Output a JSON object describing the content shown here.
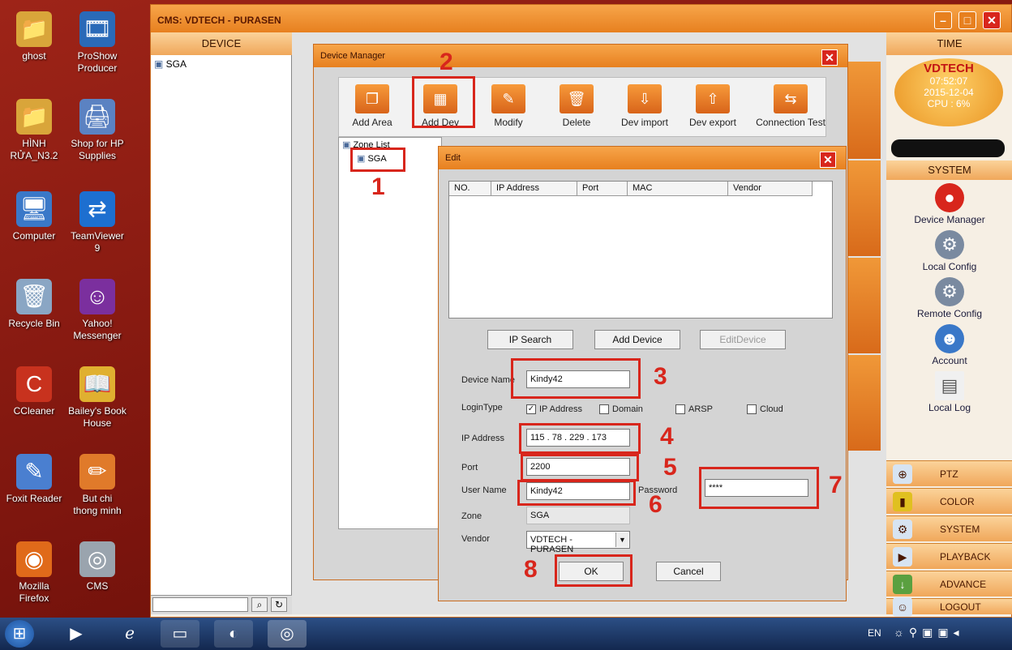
{
  "desktop_icons": [
    {
      "label": "ghost",
      "glyph": "📁"
    },
    {
      "label": "ProShow\nProducer",
      "glyph": "🎞"
    },
    {
      "label": "HÌNH\nRỬA_N3.2",
      "glyph": "📁"
    },
    {
      "label": "Shop for HP\nSupplies",
      "glyph": "🖨"
    },
    {
      "label": "Computer",
      "glyph": "🖥"
    },
    {
      "label": "TeamViewer\n9",
      "glyph": "⇄"
    },
    {
      "label": "Recycle Bin",
      "glyph": "🗑"
    },
    {
      "label": "Yahoo!\nMessenger",
      "glyph": "☺"
    },
    {
      "label": "CCleaner",
      "glyph": "C"
    },
    {
      "label": "Bailey's Book\nHouse",
      "glyph": "📖"
    },
    {
      "label": "Foxit Reader",
      "glyph": "✎"
    },
    {
      "label": "But chi\nthong minh",
      "glyph": "✏"
    },
    {
      "label": "Mozilla\nFirefox",
      "glyph": "◉"
    },
    {
      "label": "CMS",
      "glyph": "◎"
    }
  ],
  "app": {
    "title": "CMS: VDTECH - PURASEN",
    "device_header": "DEVICE",
    "time_header": "TIME",
    "device_tree_root": "SGA",
    "brand": "VDTECH",
    "time": "07:52:07",
    "date": "2015-12-04",
    "cpu": "CPU : 6%",
    "system_header": "SYSTEM",
    "system_items": [
      "Device Manager",
      "Local Config",
      "Remote Config",
      "Account",
      "Local Log"
    ],
    "nav_buttons": [
      "PTZ",
      "COLOR",
      "SYSTEM",
      "PLAYBACK",
      "ADVANCE",
      "LOGOUT"
    ]
  },
  "device_manager": {
    "title": "Device Manager",
    "toolbar": [
      "Add Area",
      "Add Dev",
      "Modify",
      "Delete",
      "Dev import",
      "Dev export",
      "Connection Test"
    ],
    "zone_list_label": "Zone List",
    "zone_item": "SGA"
  },
  "edit_dialog": {
    "title": "Edit",
    "columns": [
      "NO.",
      "IP Address",
      "Port",
      "MAC",
      "Vendor"
    ],
    "buttons": {
      "ip_search": "IP Search",
      "add_device": "Add Device",
      "edit_device": "EditDevice",
      "ok": "OK",
      "cancel": "Cancel"
    },
    "labels": {
      "device_name": "Device Name",
      "login_type": "LoginType",
      "ip_address": "IP Address",
      "port": "Port",
      "user_name": "User Name",
      "password": "Password",
      "zone": "Zone",
      "vendor": "Vendor"
    },
    "login_options": [
      {
        "label": "IP Address",
        "checked": true
      },
      {
        "label": "Domain",
        "checked": false
      },
      {
        "label": "ARSP",
        "checked": false
      },
      {
        "label": "Cloud",
        "checked": false
      }
    ],
    "values": {
      "device_name": "Kindy42",
      "ip_address": "115 . 78 . 229 . 173",
      "port": "2200",
      "user_name": "Kindy42",
      "password": "****",
      "zone": "SGA",
      "vendor": "VDTECH - PURASEN"
    }
  },
  "annotations": [
    "1",
    "2",
    "3",
    "4",
    "5",
    "6",
    "7",
    "8"
  ],
  "taskbar": {
    "lang": "EN"
  }
}
